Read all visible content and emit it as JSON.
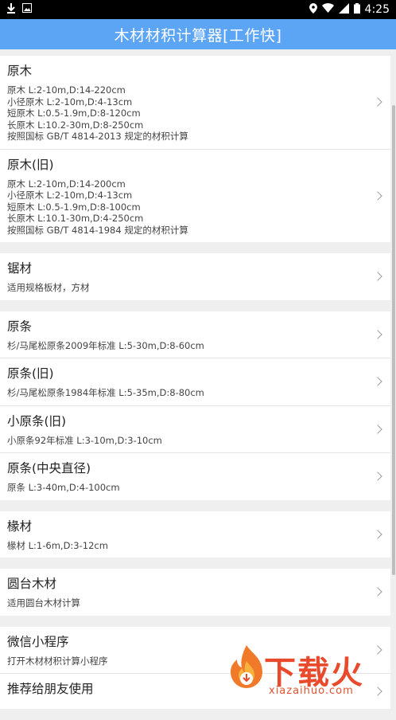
{
  "status_bar": {
    "time": "4:25",
    "left_icons": [
      "download-icon",
      "image-icon"
    ],
    "right_icons": [
      "location-icon",
      "wifi-icon",
      "signal-icon",
      "battery-icon"
    ]
  },
  "app_bar": {
    "title": "木材材积计算器[工作快]"
  },
  "groups": [
    {
      "items": [
        {
          "title": "原木",
          "desc": "原木 L:2-10m,D:14-220cm\n小径原木 L:2-10m,D:4-13cm\n短原木 L:0.5-1.9m,D:8-120cm\n长原木 L:10.2-30m,D:8-250cm\n按照国标 GB/T 4814-2013 规定的材积计算"
        },
        {
          "title": "原木(旧)",
          "desc": "原木 L:2-10m,D:14-200cm\n小径原木 L:2-10m,D:4-13cm\n短原木 L:0.5-1.9m,D:8-100cm\n长原木 L:10.1-30m,D:4-250cm\n按照国标 GB/T 4814-1984 规定的材积计算"
        }
      ]
    },
    {
      "items": [
        {
          "title": "锯材",
          "desc": "适用规格板材，方材"
        }
      ]
    },
    {
      "items": [
        {
          "title": "原条",
          "desc": "杉/马尾松原条2009年标准 L:5-30m,D:8-60cm"
        },
        {
          "title": "原条(旧)",
          "desc": "杉/马尾松原条1984年标准 L:5-35m,D:8-80cm"
        },
        {
          "title": "小原条(旧)",
          "desc": "小原条92年标准 L:3-10m,D:3-10cm"
        },
        {
          "title": "原条(中央直径)",
          "desc": "原条  L:3-40m,D:4-100cm"
        }
      ]
    },
    {
      "items": [
        {
          "title": "椽材",
          "desc": "椽材  L:1-6m,D:3-12cm"
        }
      ]
    },
    {
      "items": [
        {
          "title": "圆台木材",
          "desc": "适用圆台木材计算"
        }
      ]
    },
    {
      "items": [
        {
          "title": "微信小程序",
          "desc": "打开木材材积计算小程序"
        },
        {
          "title": "推荐给朋友使用",
          "desc": ""
        }
      ]
    }
  ],
  "watermark": {
    "text": "下载火",
    "url": "xiazaihuo.com"
  },
  "colors": {
    "app_bar": "#5ca5f5",
    "watermark": "#e84a2b"
  }
}
